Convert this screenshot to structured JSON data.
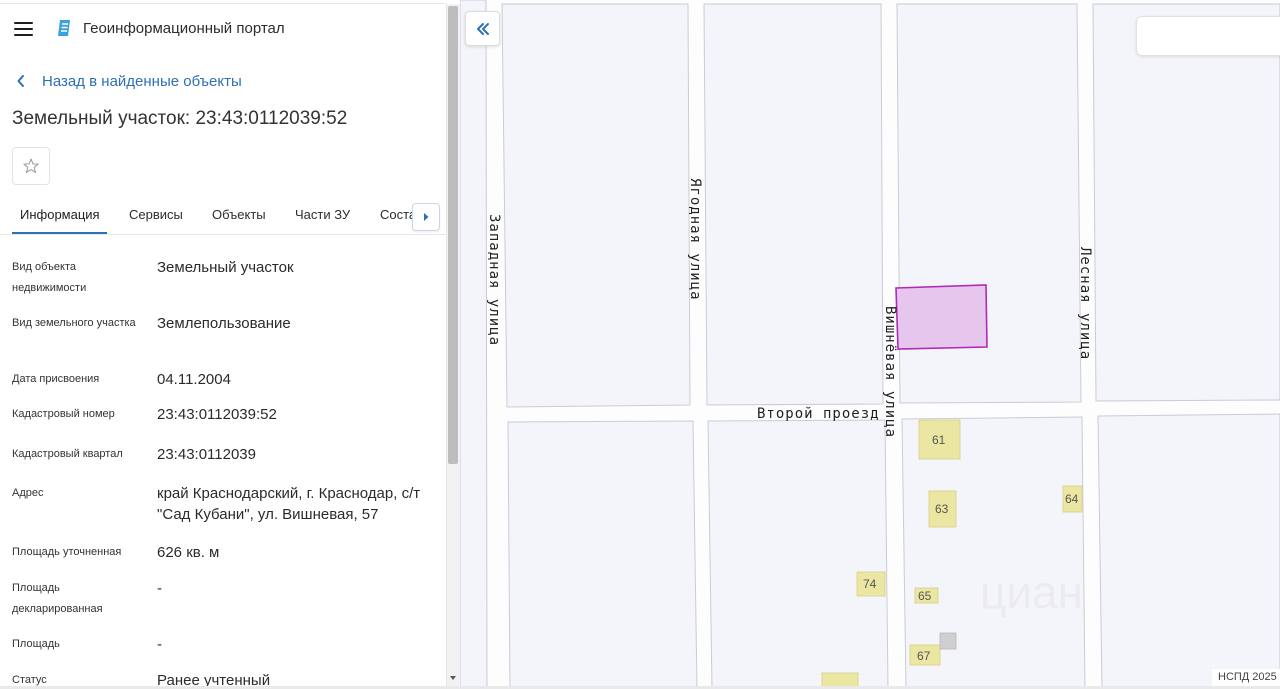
{
  "header": {
    "menu_icon": "hamburger-icon",
    "logo_icon": "portal-logo-icon",
    "title": "Геоинформационный портал"
  },
  "navigation": {
    "back_label": "Назад в найденные объекты",
    "back_icon": "chevron-left-icon"
  },
  "object": {
    "title": "Земельный участок: 23:43:0112039:52",
    "favorite_icon": "star-outline-icon"
  },
  "tabs": [
    {
      "label": "Информация",
      "active": true
    },
    {
      "label": "Сервисы",
      "active": false
    },
    {
      "label": "Объекты",
      "active": false
    },
    {
      "label": "Части ЗУ",
      "active": false
    },
    {
      "label": "Соста",
      "active": false
    }
  ],
  "properties": [
    {
      "label": "Вид объекта недвижимости",
      "value": "Земельный участок"
    },
    {
      "label": "Вид земельного участка",
      "value": "Землепользование"
    },
    {
      "label": "Дата присвоения",
      "value": "04.11.2004"
    },
    {
      "label": "Кадастровый номер",
      "value": "23:43:0112039:52"
    },
    {
      "label": "Кадастровый квартал",
      "value": "23:43:0112039"
    },
    {
      "label": "Адрес",
      "value": "край Краснодарский, г. Краснодар, с/т \"Сад Кубани\", ул. Вишневая, 57"
    },
    {
      "label": "Площадь уточненная",
      "value": "626 кв. м"
    },
    {
      "label": "Площадь декларированная",
      "value": "-"
    },
    {
      "label": "Площадь",
      "value": "-"
    },
    {
      "label": "Статус",
      "value": "Ранее учтенный"
    }
  ],
  "map": {
    "streets": [
      {
        "name": "Западная  улица"
      },
      {
        "name": "Ягодная  улица"
      },
      {
        "name": "Вишнёвая  улица"
      },
      {
        "name": "Лесная  улица"
      },
      {
        "name": "Второй  проезд"
      }
    ],
    "lot_numbers": [
      "61",
      "63",
      "64",
      "65",
      "67",
      "74"
    ],
    "watermark": "циан",
    "attribution": "НСПД 2025",
    "colors": {
      "parcel_fill": "#e6c6ec",
      "parcel_stroke": "#b02ab8",
      "block_fill": "#f4f5fa",
      "block_stroke": "#c9ccd6",
      "building_fill": "#ebe7a2",
      "link": "#2e6fb8"
    }
  }
}
